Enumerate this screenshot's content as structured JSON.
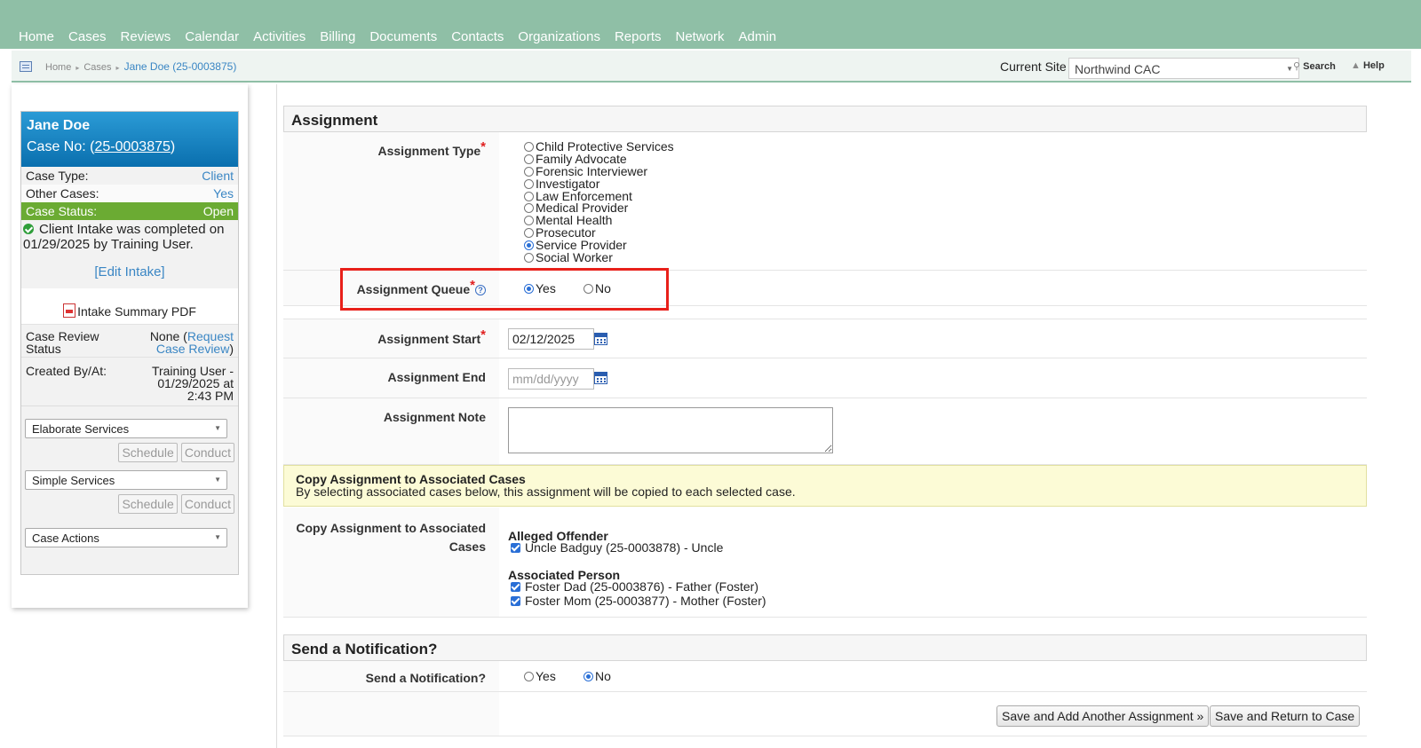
{
  "nav": [
    "Home",
    "Cases",
    "Reviews",
    "Calendar",
    "Activities",
    "Billing",
    "Documents",
    "Contacts",
    "Organizations",
    "Reports",
    "Network",
    "Admin"
  ],
  "breadcrumb": {
    "home": "Home",
    "cases": "Cases",
    "current": "Jane Doe (25-0003875)"
  },
  "site": {
    "label": "Current Site",
    "value": "Northwind CAC"
  },
  "tools": {
    "search": "Search",
    "help": "Help"
  },
  "card": {
    "name": "Jane Doe",
    "case_no_label": "Case No: (",
    "case_no": "25-0003875",
    "case_no_close": ")",
    "case_type_label": "Case Type:",
    "case_type": "Client",
    "other_cases_label": "Other Cases:",
    "other_cases": "Yes",
    "status_label": "Case Status:",
    "status": "Open",
    "intake_text": "Client Intake was completed on 01/29/2025 by Training User.",
    "edit_intake": "[Edit Intake]",
    "pdf_label": "Intake Summary PDF",
    "review_label_1": "Case Review",
    "review_label_2": "Status",
    "review_none": "None (",
    "review_link_1": "Request",
    "review_link_2": "Case Review",
    "review_close": ")",
    "created_label": "Created By/At:",
    "created_1": "Training User -",
    "created_2": "01/29/2025 at",
    "created_3": "2:43 PM",
    "dd_elaborate": "Elaborate Services",
    "dd_simple": "Simple Services",
    "dd_actions": "Case Actions",
    "schedule": "Schedule",
    "conduct": "Conduct"
  },
  "assignment": {
    "title": "Assignment",
    "type_label": "Assignment Type",
    "types": [
      "Child Protective Services",
      "Family Advocate",
      "Forensic Interviewer",
      "Investigator",
      "Law Enforcement",
      "Medical Provider",
      "Mental Health",
      "Prosecutor",
      "Service Provider",
      "Social Worker"
    ],
    "selected_type": "Service Provider",
    "queue_label": "Assignment Queue",
    "queue_help": "?",
    "yes": "Yes",
    "no": "No",
    "queue_value": "Yes",
    "start_label": "Assignment Start",
    "start_value": "02/12/2025",
    "end_label": "Assignment End",
    "end_placeholder": "mm/dd/yyyy",
    "note_label": "Assignment Note",
    "note_value": ""
  },
  "copy": {
    "notice_title": "Copy Assignment to Associated Cases",
    "notice_text": "By selecting associated cases below, this assignment will be copied to each selected case.",
    "label_1": "Copy Assignment to Associated",
    "label_2": "Cases",
    "group_offender": "Alleged Offender",
    "offender_1": "Uncle Badguy (25-0003878) - Uncle",
    "group_person": "Associated Person",
    "person_1": "Foster Dad (25-0003876) - Father (Foster)",
    "person_2": "Foster Mom (25-0003877) - Mother (Foster)"
  },
  "notification": {
    "title": "Send a Notification?",
    "label": "Send a Notification?",
    "yes": "Yes",
    "no": "No",
    "value": "No"
  },
  "actions": {
    "save_add": "Save and Add Another Assignment »",
    "save_return": "Save and Return to Case"
  },
  "colors": {
    "nav_bg": "#8fbfa6",
    "highlight": "#e8201a",
    "status_bg": "#6bab33",
    "card_head": "#0a6fae"
  }
}
